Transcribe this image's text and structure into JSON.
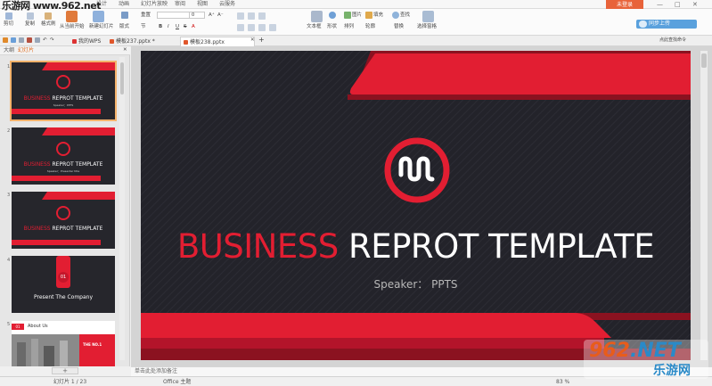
{
  "watermark_top": "乐游网 www.962.net",
  "menu": [
    "设计",
    "动画",
    "幻灯片放映",
    "审阅",
    "视图",
    "云服务"
  ],
  "login_label": "未登录",
  "sync_label": "同步上传",
  "ribbon": {
    "row1": [
      "剪切",
      "复制",
      "粘贴",
      "从当前开始",
      "新建幻灯片",
      "版式",
      "重置",
      "文本框",
      "形状",
      "图片",
      "填充",
      "查找",
      "选择窗格"
    ],
    "row2": [
      "格式刷",
      "节",
      "排列",
      "轮廓",
      "替换"
    ],
    "font_size": "0",
    "font_buttons": [
      "B",
      "I",
      "U",
      "S",
      "A"
    ]
  },
  "tabs": {
    "wps_tab": "我的WPS",
    "doc1": "模板237.pptx *",
    "doc2": "模板238.pptx",
    "add": "+",
    "right_hint": "点此查找命令"
  },
  "panel_tabs": [
    "大纲",
    "幻灯片"
  ],
  "thumbs": [
    {
      "num": "1",
      "title_red": "BUSINESS",
      "title_white": "REPROT TEMPLATE",
      "sub": "Speaker：PPTS"
    },
    {
      "num": "2",
      "title_red": "BUSINESS",
      "title_white": "REPROT TEMPLATE",
      "sub": "Speaker：Presenter title"
    },
    {
      "num": "3",
      "title_red": "BUSINESS",
      "title_white": "REPROT TEMPLATE",
      "sub": ""
    },
    {
      "num": "4",
      "badge": "01",
      "label": "Present The Company"
    },
    {
      "num": "5",
      "badge": "01",
      "label": "About Us",
      "inner": "THE NO.1"
    }
  ],
  "slide": {
    "title_red": "BUSINESS",
    "title_white": "REPROT TEMPLATE",
    "speaker": "Speaker：  PPTS",
    "accent": "#e21e32",
    "bg": "#23232a"
  },
  "notes_placeholder": "单击此处添加备注",
  "status": {
    "slide_count": "幻灯片 1 / 23",
    "theme": "Office 主题",
    "zoom": "83 %"
  },
  "watermark_logo": {
    "top": "962",
    "top_suffix": ".NET",
    "bottom": "乐游网"
  }
}
